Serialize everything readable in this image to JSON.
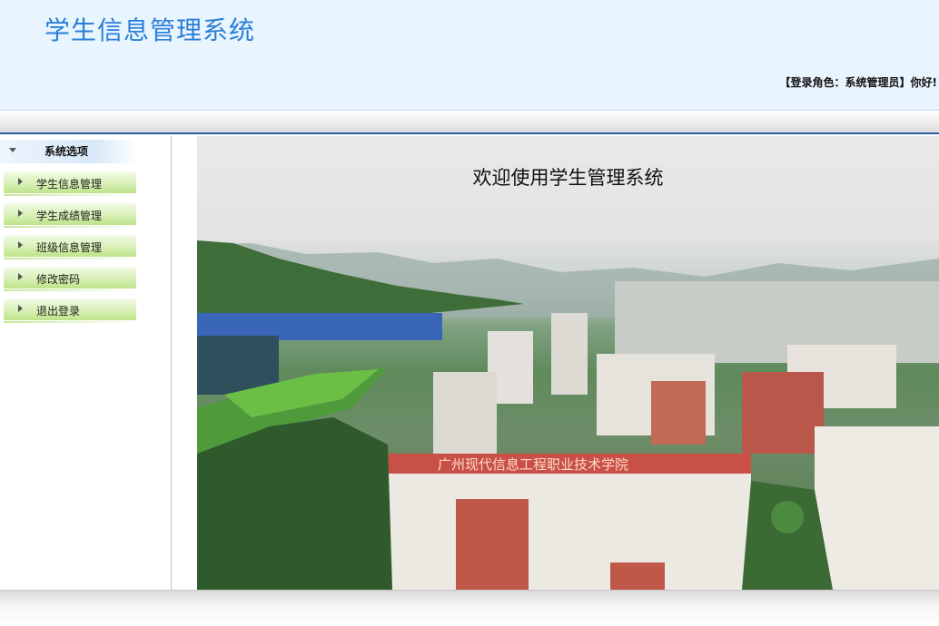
{
  "header": {
    "title": "学生信息管理系统",
    "role_info": "【登录角色：系统管理员】你好!"
  },
  "sidebar": {
    "section_title": "系统选项",
    "items": [
      {
        "label": "学生信息管理"
      },
      {
        "label": "学生成绩管理"
      },
      {
        "label": "班级信息管理"
      },
      {
        "label": "修改密码"
      },
      {
        "label": "退出登录"
      }
    ]
  },
  "main": {
    "welcome_text": "欢迎使用学生管理系统",
    "banner_text": "广州现代信息工程职业技术学院"
  },
  "colors": {
    "title": "#2a7fd8",
    "header_bg": "#e8f4fe",
    "menu_green": "#bde38a",
    "nav_border": "#2f5fa0"
  }
}
